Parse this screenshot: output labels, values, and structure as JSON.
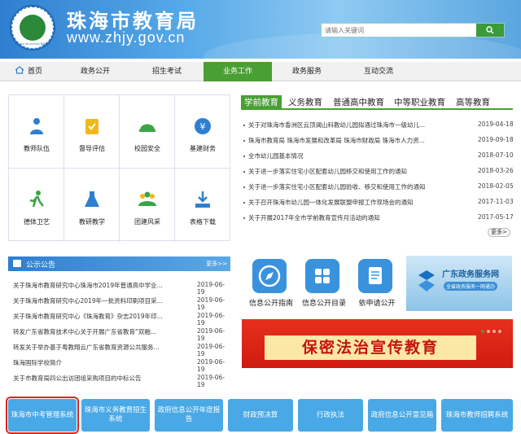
{
  "header": {
    "logo_text": "ZHUHAI EDUCATION 珠海教育",
    "title": "珠海市教育局",
    "url": "www.zhjy.gov.cn",
    "search_placeholder": "请输入关键词"
  },
  "nav": {
    "items": [
      "首页",
      "政务公开",
      "招生考试",
      "业务工作",
      "政务服务",
      "互动交流"
    ],
    "active_index": 3
  },
  "tiles": [
    "教师队伍",
    "督导评估",
    "校园安全",
    "基建财务",
    "德体卫艺",
    "教研教学",
    "团建风采",
    "表格下载"
  ],
  "tabs": {
    "items": [
      "学前教育",
      "义务教育",
      "普通高中教育",
      "中等职业教育",
      "高等教育"
    ],
    "active_index": 0
  },
  "news": [
    {
      "title": "关于对珠海市香洲区云顶澜山科教幼儿园拟通过珠海市一级幼儿...",
      "date": "2019-04-18"
    },
    {
      "title": "珠海市教育局 珠海市发展和改革局 珠海市财政局 珠海市人力资...",
      "date": "2019-09-18"
    },
    {
      "title": "全市幼儿园基本情况",
      "date": "2018-07-10"
    },
    {
      "title": "关于进一步落实住宅小区配套幼儿园移交和使用工作的通知",
      "date": "2018-03-26"
    },
    {
      "title": "关于进一步落实住宅小区配套幼儿园验收、移交和使用工作的通知",
      "date": "2018-02-05"
    },
    {
      "title": "关于召开珠海市幼儿园一体化发展联盟申报工作现场会的通知",
      "date": "2017-11-03"
    },
    {
      "title": "关于开展2017年全市学前教育宣传月活动的通知",
      "date": "2017-05-17"
    }
  ],
  "news_more": "更多>",
  "notice": {
    "title": "公示公告",
    "more": "更多>>",
    "items": [
      {
        "title": "关于珠海市教育研究中心珠海市2019年普通高中学业...",
        "date": "2019-06-19"
      },
      {
        "title": "关于珠海市教育研究中心2019年一批资料印刷项目采...",
        "date": "2019-06-19"
      },
      {
        "title": "关于珠海市教育研究中心《珠海教育》杂志2019年印...",
        "date": "2019-06-19"
      },
      {
        "title": "转发广东省教育技术中心关于开展广东省教育“双融...",
        "date": "2019-06-19"
      },
      {
        "title": "转发关于举办基于粤教翔云广东省教育资源公共服务...",
        "date": "2019-06-19"
      },
      {
        "title": "珠海国际学校简介",
        "date": "2019-06-19"
      },
      {
        "title": "关于市教育局四公出访团组采购项目的中标公告",
        "date": "2019-06-19"
      }
    ]
  },
  "services": [
    "信息公开指南",
    "信息公开目录",
    "依申请公开"
  ],
  "gd_service": {
    "title": "广东政务服务网",
    "subtitle": "全省政务服务一网通办"
  },
  "banner": {
    "text": "保密法治宣传教育"
  },
  "quick_buttons": [
    "珠海市中考管理系统",
    "珠海市义务教育招生系统",
    "政府信息公开年度报告",
    "财政预决算",
    "行政执法",
    "政府信息公开意见箱",
    "珠海市教师招聘系统"
  ],
  "colors": {
    "primary_blue": "#2f7fd0",
    "green": "#4a9f34",
    "button_blue": "#49a8e6",
    "banner_red": "#d01b10"
  }
}
